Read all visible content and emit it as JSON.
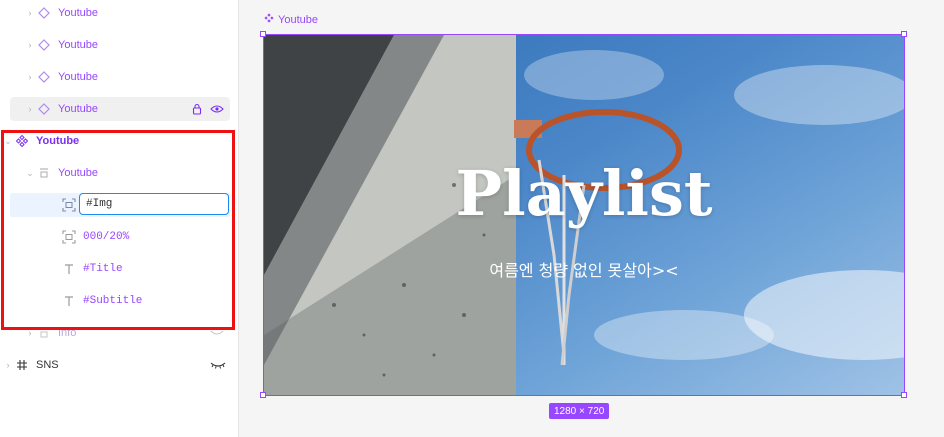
{
  "layers": {
    "rows": [
      {
        "label": "Youtube"
      },
      {
        "label": "Youtube"
      },
      {
        "label": "Youtube"
      },
      {
        "label": "Youtube"
      },
      {
        "label": "Youtube"
      },
      {
        "label": "Youtube"
      },
      {
        "label": "#Img"
      },
      {
        "label": "000/20%"
      },
      {
        "label": "#Title"
      },
      {
        "label": "#Subtitle"
      },
      {
        "label": "Info"
      },
      {
        "label": "SNS"
      }
    ],
    "rename_value": "#Img"
  },
  "canvas": {
    "frame_title": "Youtube",
    "size_label": "1280 × 720",
    "headline": "Playlist",
    "subhead": "여름엔 청량 없인 못살아><"
  },
  "colors": {
    "accent": "#9747ff",
    "selection": "#1d8bf2",
    "highlight_box": "#ee1111"
  }
}
